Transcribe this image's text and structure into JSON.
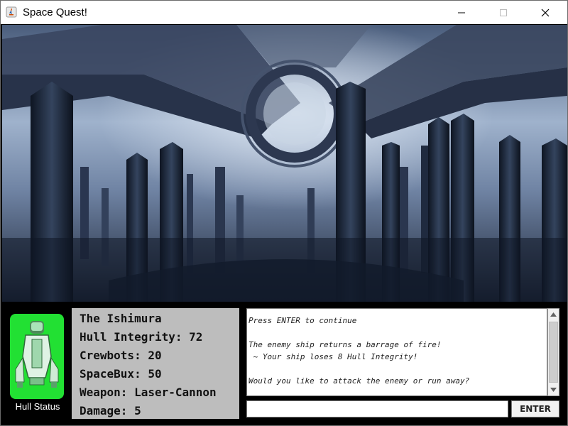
{
  "window": {
    "title": "Space Quest!"
  },
  "hull_status": {
    "label": "Hull Status",
    "indicator_color": "#22e033"
  },
  "ship_stats": {
    "name": "The Ishimura",
    "hull_integrity": "Hull Integrity: 72",
    "crewbots": "Crewbots: 20",
    "spacebux": "SpaceBux: 50",
    "weapon": "Weapon: Laser-Cannon",
    "damage": "Damage: 5"
  },
  "log": {
    "lines": [
      "Press ENTER to continue",
      "",
      "The enemy ship returns a barrage of fire!",
      " ~ Your ship loses 8 Hull Integrity!",
      "",
      "Would you like to attack the enemy or run away?"
    ]
  },
  "command": {
    "value": "",
    "enter_label": "ENTER"
  },
  "icons": [
    "java-app-icon",
    "minimize-icon",
    "maximize-icon",
    "close-icon",
    "spaceship-icon",
    "scroll-up-icon",
    "scroll-down-icon"
  ]
}
